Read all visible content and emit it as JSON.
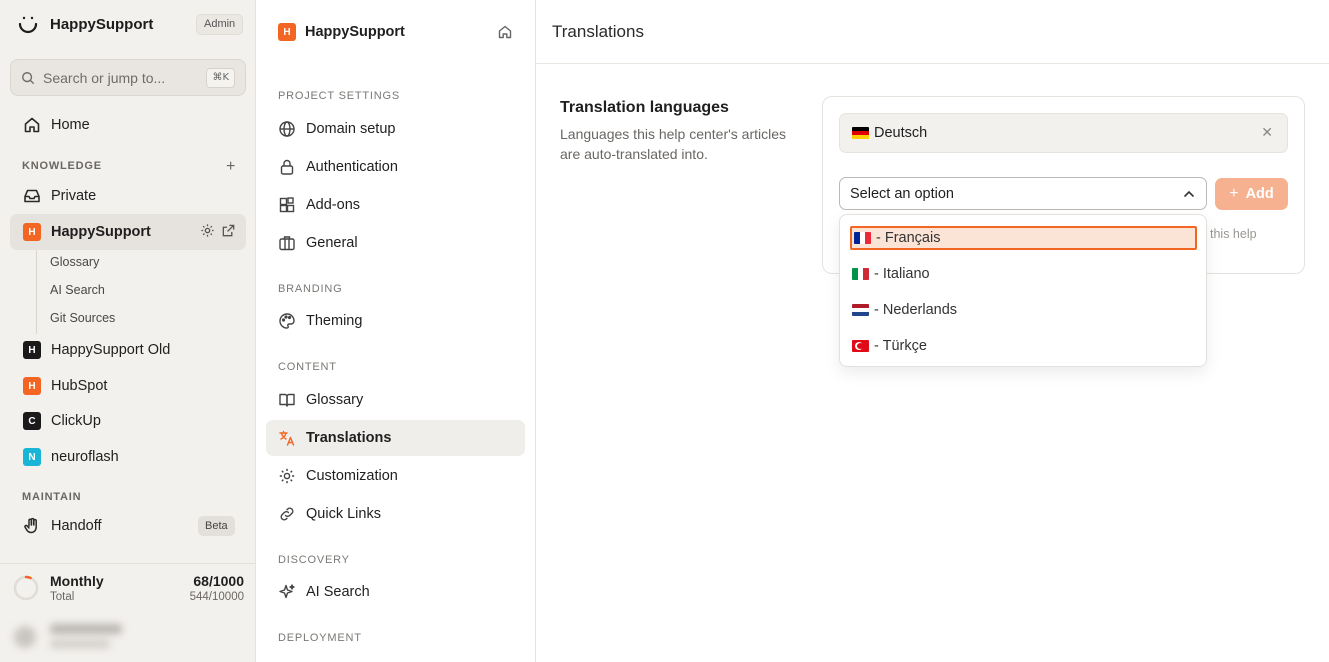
{
  "sidebar": {
    "brand": "HappySupport",
    "role_badge": "Admin",
    "search_placeholder": "Search or jump to...",
    "search_shortcut": "⌘K",
    "home_label": "Home",
    "knowledge_label": "KNOWLEDGE",
    "private_label": "Private",
    "projects": [
      {
        "initial": "H",
        "label": "HappySupport"
      },
      {
        "initial": "H",
        "label": "HappySupport Old"
      },
      {
        "initial": "H",
        "label": "HubSpot"
      },
      {
        "initial": "C",
        "label": "ClickUp"
      },
      {
        "initial": "N",
        "label": "neuroflash"
      }
    ],
    "sub_items": [
      "Glossary",
      "AI Search",
      "Git Sources"
    ],
    "maintain_label": "MAINTAIN",
    "handoff_label": "Handoff",
    "beta_badge": "Beta",
    "usage": {
      "label": "Monthly",
      "sub_label": "Total",
      "value": "68/1000",
      "total": "544/10000",
      "fraction": 0.068
    }
  },
  "settings_nav": {
    "project_initial": "H",
    "project_name": "HappySupport",
    "sections": {
      "project_settings": "PROJECT SETTINGS",
      "branding": "BRANDING",
      "content": "CONTENT",
      "discovery": "DISCOVERY",
      "deployment": "DEPLOYMENT"
    },
    "items": {
      "domain": "Domain setup",
      "auth": "Authentication",
      "addons": "Add-ons",
      "general": "General",
      "theming": "Theming",
      "glossary": "Glossary",
      "translations": "Translations",
      "customization": "Customization",
      "quicklinks": "Quick Links",
      "aisearch": "AI Search"
    }
  },
  "main": {
    "page_title": "Translations",
    "section_title": "Translation languages",
    "section_desc": "Languages this help center's articles are auto-translated into.",
    "selected_language": "Deutsch",
    "select_placeholder": "Select an option",
    "add_label": "Add",
    "hint_partial": "this help",
    "options": [
      "- Français",
      "- Italiano",
      "- Nederlands",
      "- Türkçe"
    ]
  },
  "colors": {
    "accent": "#f26522",
    "accent_light": "#f6b191",
    "sidebar_bg": "#f3f1ee"
  }
}
